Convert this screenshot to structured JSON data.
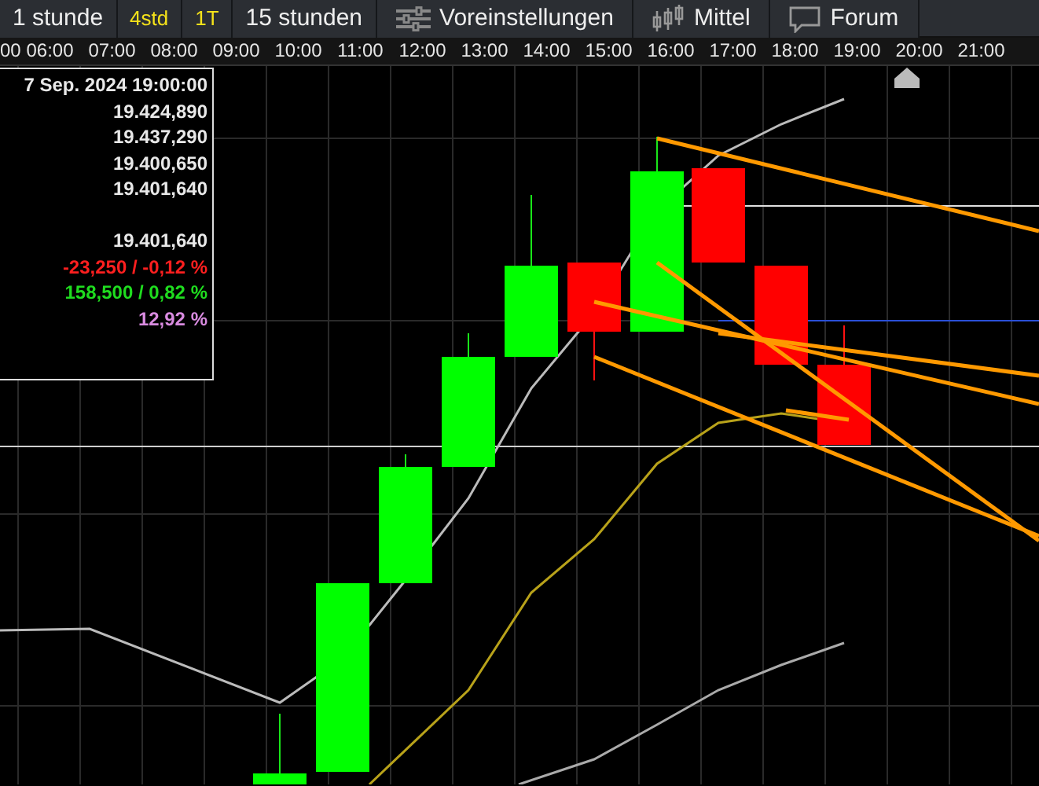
{
  "toolbar": [
    {
      "kind": "timeframe",
      "label": "1 stunde",
      "highlighted": false
    },
    {
      "kind": "timeframe",
      "label": "4std",
      "highlighted": true
    },
    {
      "kind": "timeframe",
      "label": "1T",
      "highlighted": true
    },
    {
      "kind": "timeframe",
      "label": "15 stunden",
      "highlighted": false
    },
    {
      "kind": "menu",
      "label": "Voreinstellungen",
      "highlighted": false
    },
    {
      "kind": "menu",
      "label": "Mittel",
      "highlighted": false
    },
    {
      "kind": "menu",
      "label": "Forum",
      "highlighted": false
    }
  ],
  "time_axis": [
    "00",
    "06:00",
    "07:00",
    "08:00",
    "09:00",
    "10:00",
    "11:00",
    "12:00",
    "13:00",
    "14:00",
    "15:00",
    "16:00",
    "17:00",
    "18:00",
    "19:00",
    "20:00",
    "21:00"
  ],
  "info_box": [
    {
      "kind": "date",
      "text": "7 Sep. 2024 19:00:00"
    },
    {
      "kind": "value",
      "text": "19.424,890"
    },
    {
      "kind": "value",
      "text": "19.437,290"
    },
    {
      "kind": "value",
      "text": "19.400,650"
    },
    {
      "kind": "value",
      "text": "19.401,640"
    },
    {
      "kind": "close",
      "text": "19.401,640"
    },
    {
      "kind": "down",
      "text": "-23,250 / -0,12 %"
    },
    {
      "kind": "up",
      "text": "158,500 / 0,82 %"
    },
    {
      "kind": "percent",
      "text": "12,92 %"
    }
  ]
}
